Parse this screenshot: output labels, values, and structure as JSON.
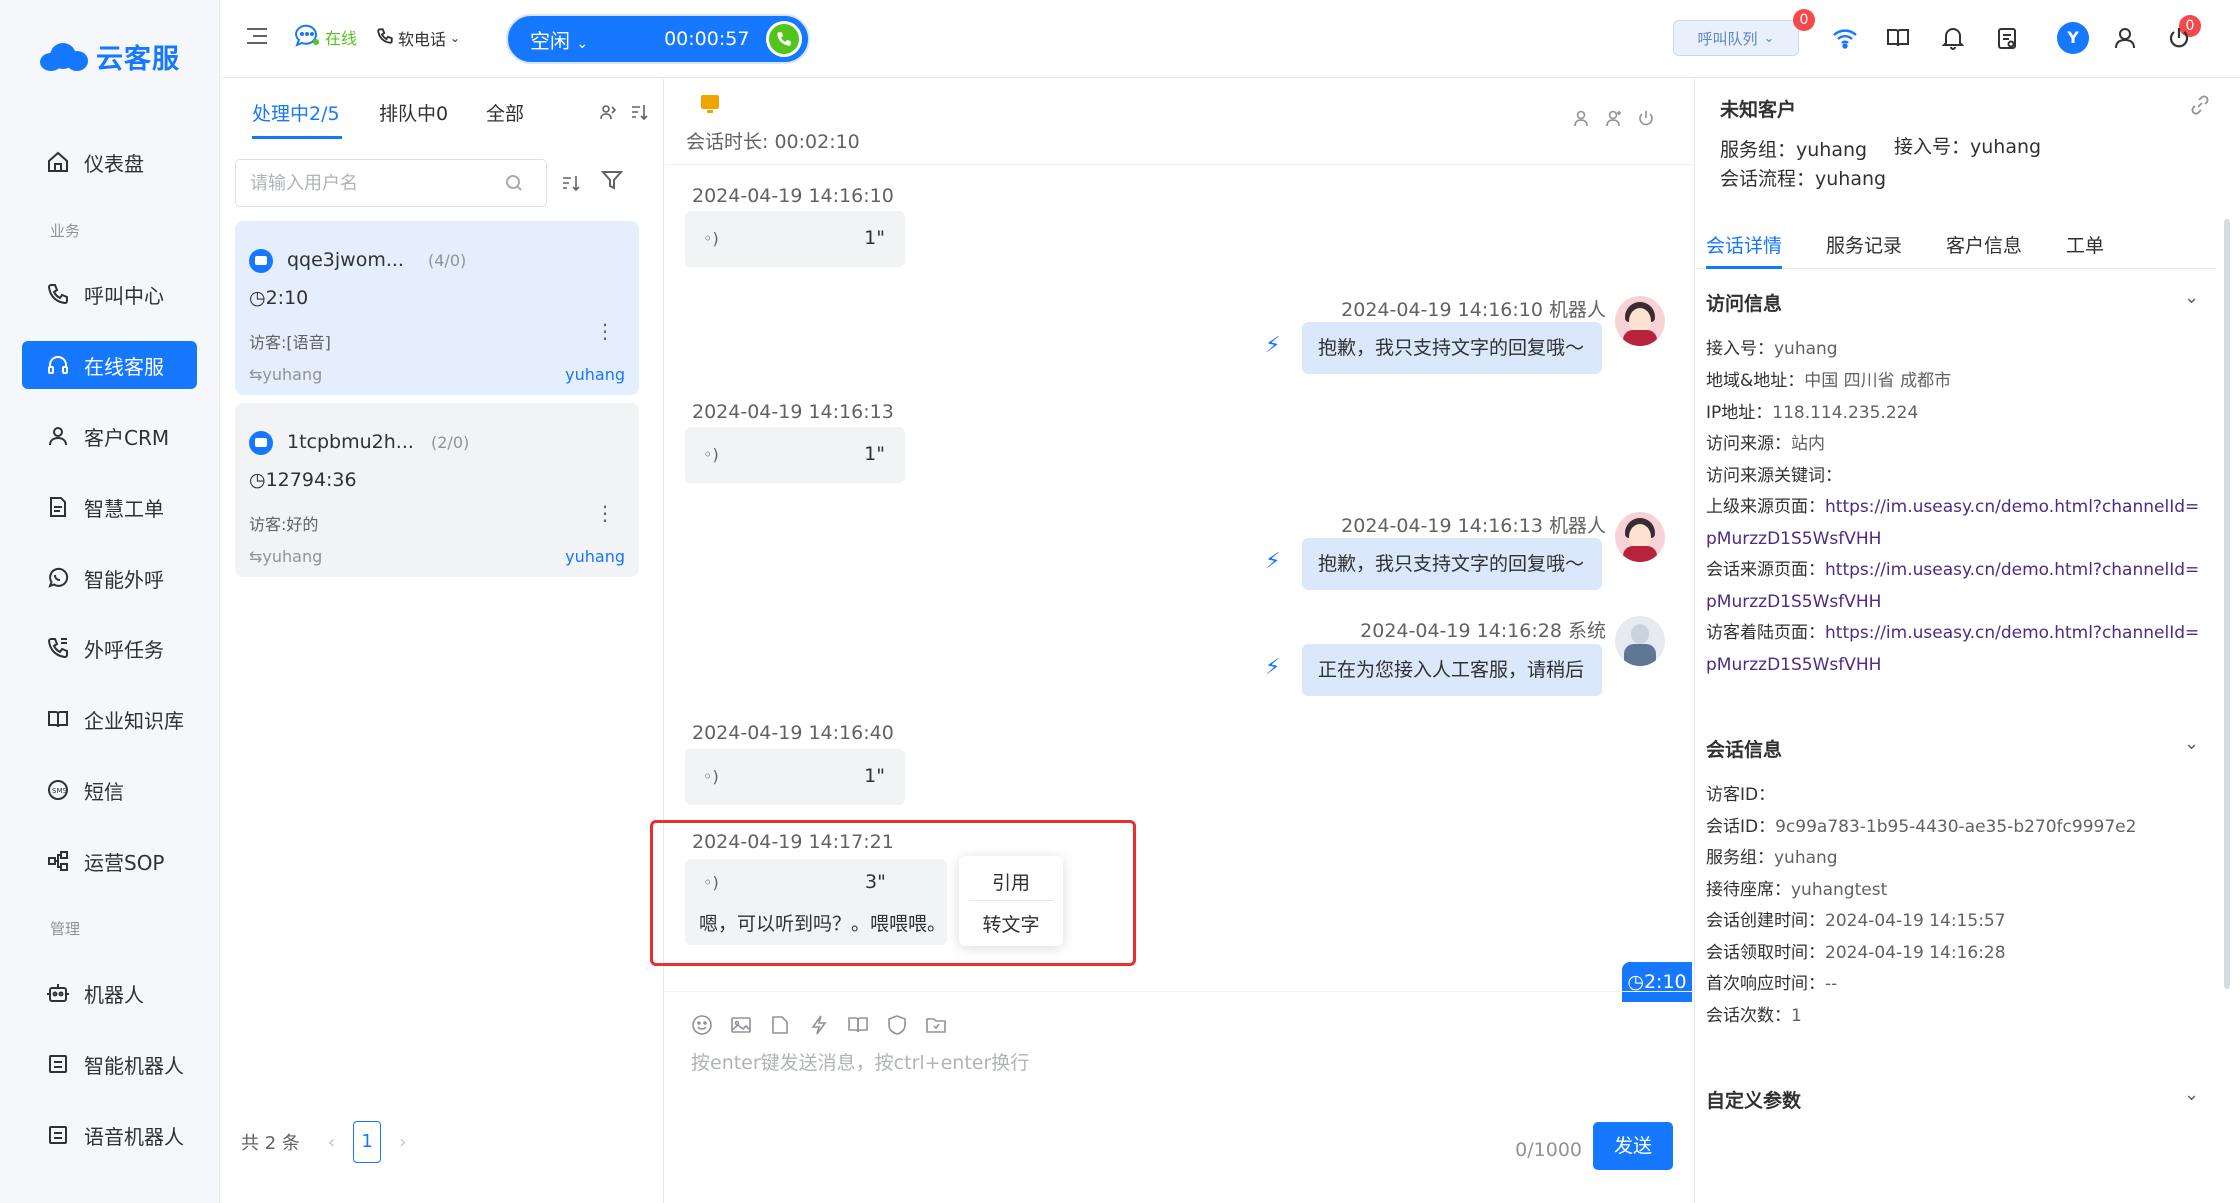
{
  "app": {
    "logo_text": "云客服",
    "brand_color": "#1677ff"
  },
  "sidebar": {
    "items": [
      {
        "label": "仪表盘",
        "icon": "home-icon"
      },
      {
        "label": "呼叫中心",
        "icon": "phone-icon"
      },
      {
        "label": "在线客服",
        "icon": "headset-icon",
        "active": true
      },
      {
        "label": "客户CRM",
        "icon": "user-icon"
      },
      {
        "label": "智慧工单",
        "icon": "document-icon"
      },
      {
        "label": "智能外呼",
        "icon": "whatsapp-icon"
      },
      {
        "label": "外呼任务",
        "icon": "outbound-call-icon"
      },
      {
        "label": "企业知识库",
        "icon": "book-icon"
      },
      {
        "label": "短信",
        "icon": "sms-icon"
      },
      {
        "label": "运营SOP",
        "icon": "flow-icon"
      },
      {
        "label": "机器人",
        "icon": "robot-icon"
      },
      {
        "label": "智能机器人",
        "icon": "smart-robot-icon"
      },
      {
        "label": "语音机器人",
        "icon": "voice-robot-icon"
      }
    ],
    "sections": {
      "business": "业务",
      "management": "管理"
    }
  },
  "topbar": {
    "status": "在线",
    "softphone": "软电话",
    "call_state": "空闲",
    "call_timer": "00:00:57",
    "queue_label": "呼叫队列",
    "queue_badge": "0",
    "notify_badge": "0",
    "user_avatar": "Y"
  },
  "sessions": {
    "tabs": [
      "处理中2/5",
      "排队中0",
      "全部"
    ],
    "search_placeholder": "请输入用户名",
    "items": [
      {
        "name": "qqe3jwom...",
        "count": "(4/0)",
        "time": "2:10",
        "last_msg": "访客:[语音]",
        "group": "yuhang",
        "agent": "yuhang"
      },
      {
        "name": "1tcpbmu2h...",
        "count": "(2/0)",
        "time": "12794:36",
        "last_msg": "访客:好的",
        "group": "yuhang",
        "agent": "yuhang"
      }
    ],
    "total": "共 2 条",
    "page": "1"
  },
  "chat": {
    "duration": "会话时长: 00:02:10",
    "messages": [
      {
        "time": "2024-04-19 14:16:10",
        "duration": "1\""
      },
      {
        "time": "2024-04-19 14:16:10 机器人",
        "text": "抱歉，我只支持文字的回复哦～"
      },
      {
        "time": "2024-04-19 14:16:13",
        "duration": "1\""
      },
      {
        "time": "2024-04-19 14:16:13 机器人",
        "text": "抱歉，我只支持文字的回复哦～"
      },
      {
        "time": "2024-04-19 14:16:28 系统",
        "text": "正在为您接入人工客服，请稍后"
      },
      {
        "time": "2024-04-19 14:16:40",
        "duration": "1\""
      },
      {
        "time": "2024-04-19 14:17:21",
        "duration": "3\"",
        "transcript": "嗯，可以听到吗？。喂喂喂。"
      }
    ],
    "context_menu": {
      "quote": "引用",
      "to_text": "转文字"
    },
    "float_timer": "2:10",
    "input_placeholder": "按enter键发送消息，按ctrl+enter换行",
    "char_counter": "0/1000",
    "send_label": "发送"
  },
  "customer": {
    "title": "未知客户",
    "service_group": "服务组：yuhang",
    "access_no": "接入号：yuhang",
    "flow": "会话流程：yuhang",
    "tabs": [
      "会话详情",
      "服务记录",
      "客户信息",
      "工单"
    ],
    "visit_info": {
      "title": "访问信息",
      "access_no": "接入号：",
      "access_no_val": "yuhang",
      "region": "地域&地址：",
      "region_val": "中国 四川省 成都市",
      "ip": "IP地址：",
      "ip_val": "118.114.235.224",
      "source": "访问来源：",
      "source_val": "站内",
      "keywords": "访问来源关键词：",
      "parent_page": "上级来源页面：",
      "parent_page_val": "https://im.useasy.cn/demo.html?channelId=",
      "parent_page_val2": "pMurzzD1S5WsfVHH",
      "session_page": "会话来源页面：",
      "session_page_val": "https://im.useasy.cn/demo.html?channelId=",
      "session_page_val2": "pMurzzD1S5WsfVHH",
      "landing_page": "访客着陆页面：",
      "landing_page_val": "https://im.useasy.cn/demo.html?channelId=",
      "landing_page_val2": "pMurzzD1S5WsfVHH"
    },
    "session_info": {
      "title": "会话信息",
      "visitor_id": "访客ID：",
      "session_id": "会话ID：",
      "session_id_val": "9c99a783-1b95-4430-ae35-b270fc9997e2",
      "group": "服务组：",
      "group_val": "yuhang",
      "seat": "接待座席：",
      "seat_val": "yuhangtest",
      "created": "会话创建时间：",
      "created_val": "2024-04-19 14:15:57",
      "claimed": "会话领取时间：",
      "claimed_val": "2024-04-19 14:16:28",
      "first_resp": "首次响应时间：",
      "first_resp_val": "--",
      "count": "会话次数：",
      "count_val": "1"
    },
    "custom_params": {
      "title": "自定义参数"
    }
  }
}
